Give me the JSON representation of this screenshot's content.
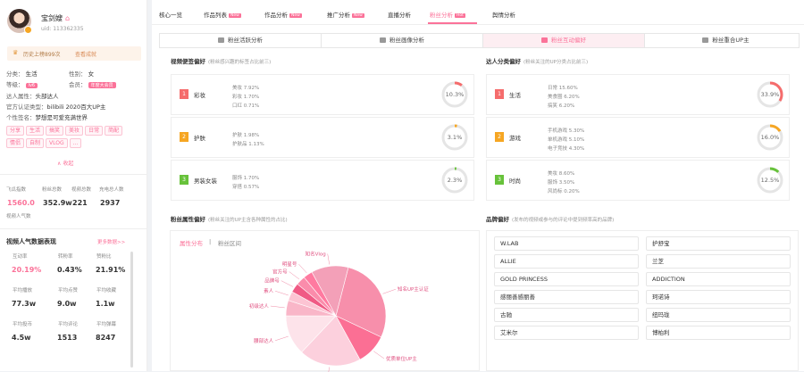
{
  "profile": {
    "name": "宝剑嫂",
    "uid": "uid: 113362335",
    "history_text": "历史上榜899次",
    "history_link": "查看成就",
    "category_label": "分类：",
    "category_value": "生活",
    "gender_label": "性别：",
    "gender_value": "女",
    "level_label": "等级：",
    "level_value": "lv6",
    "member_label": "会员：",
    "member_value": "年度大会员",
    "attr_label": "达人属性：",
    "attr_value": "头部达人",
    "cert_label": "官方认证类型：",
    "cert_value": "bilibili 2020百大UP主",
    "sign_label": "个性签名：",
    "sign_value": "梦想是可爱充满世界",
    "tags": [
      "分享",
      "生活",
      "搞笑",
      "美妆",
      "日常",
      "简配",
      "情侣",
      "自制",
      "VLOG",
      "..."
    ],
    "collapse_label": "收起"
  },
  "stats1": {
    "labels": [
      "飞瓜指数",
      "粉丝总数",
      "视频总数",
      "充电总人数"
    ],
    "values": [
      "1560.0",
      "352.9w",
      "221",
      "2937"
    ],
    "sub_label": "视频人气数"
  },
  "popularity": {
    "title": "视频人气数据表现",
    "more": "更多数据>>",
    "rows": [
      {
        "labels": [
          "互动率",
          "转粉率",
          "赞粉比"
        ],
        "values": [
          "20.19%",
          "0.43%",
          "21.91%"
        ]
      },
      {
        "labels": [
          "平均播放",
          "平均点赞",
          "平均收藏"
        ],
        "values": [
          "77.3w",
          "9.0w",
          "1.1w"
        ]
      },
      {
        "labels": [
          "平均投币",
          "平均评论",
          "平均弹幕"
        ],
        "values": [
          "4.5w",
          "1513",
          "8247"
        ]
      }
    ]
  },
  "nav": {
    "items": [
      {
        "label": "核心一览",
        "badge": ""
      },
      {
        "label": "作品列表",
        "badge": "New"
      },
      {
        "label": "作品分析",
        "badge": "New"
      },
      {
        "label": "推广分析",
        "badge": "New"
      },
      {
        "label": "直播分析",
        "badge": ""
      },
      {
        "label": "粉丝分析",
        "badge": "Hot"
      },
      {
        "label": "舆情分析",
        "badge": ""
      }
    ]
  },
  "subtabs": [
    "粉丝活跃分析",
    "粉丝画像分析",
    "粉丝互动偏好",
    "粉丝重合UP主"
  ],
  "video_pref": {
    "title": "视频便签偏好",
    "hint": "(粉丝感兴趣的标签占比前三)",
    "items": [
      {
        "rank": "1",
        "name": "彩妆",
        "subs": [
          "美妆 7.92%",
          "彩妆 1.70%",
          "口红 0.71%"
        ],
        "pct": "10.3%",
        "value": 10.3
      },
      {
        "rank": "2",
        "name": "护肤",
        "subs": [
          "护肤 1.98%",
          "护肤品 1.13%"
        ],
        "pct": "3.1%",
        "value": 3.1
      },
      {
        "rank": "3",
        "name": "男装女装",
        "subs": [
          "服饰 1.70%",
          "穿搭 0.57%"
        ],
        "pct": "2.3%",
        "value": 2.3
      }
    ]
  },
  "up_pref": {
    "title": "达人分类偏好",
    "hint": "(粉丝关注的UP分类占比前三)",
    "items": [
      {
        "rank": "1",
        "name": "生活",
        "subs": [
          "日常 15.60%",
          "美食圈 6.20%",
          "搞笑 6.20%"
        ],
        "pct": "33.9%",
        "value": 33.9
      },
      {
        "rank": "2",
        "name": "游戏",
        "subs": [
          "手机游戏 5.30%",
          "单机游戏 5.10%",
          "电子竞技 4.30%"
        ],
        "pct": "16.0%",
        "value": 16.0
      },
      {
        "rank": "3",
        "name": "时尚",
        "subs": [
          "美妆 8.60%",
          "服饰 3.50%",
          "风尚标 0.20%"
        ],
        "pct": "12.5%",
        "value": 12.5
      }
    ]
  },
  "fan_attr": {
    "title": "粉丝属性偏好",
    "hint": "(粉丝关注的UP主含各种属性的占比)",
    "tab_active": "属性分布",
    "tab_other": "粉丝区间"
  },
  "chart_data": {
    "type": "pie",
    "series": [
      {
        "label": "知名UP主认证",
        "value": 28
      },
      {
        "label": "优质单位UP主",
        "value": 10
      },
      {
        "label": "头部达人",
        "value": 20
      },
      {
        "label": "腰部达人",
        "value": 13
      },
      {
        "label": "初级达人",
        "value": 5
      },
      {
        "label": "素人",
        "value": 3
      },
      {
        "label": "品牌号",
        "value": 3
      },
      {
        "label": "官方号",
        "value": 3
      },
      {
        "label": "明星号",
        "value": 3
      },
      {
        "label": "知名Vlog",
        "value": 12
      }
    ]
  },
  "brand_pref": {
    "title": "品牌偏好",
    "hint": "(发布的视频或参与的评论中提到频率高的品牌)",
    "brands": [
      "W.LAB",
      "护舒宝",
      "ALLIE",
      "兰芝",
      "GOLD PRINCESS",
      "ADDICTION",
      "感丽善感丽善",
      "珂诺诗",
      "古驰",
      "纽玛珑",
      "艾米尔",
      "博柏利"
    ]
  },
  "colors": {
    "accent": "#fb7299",
    "rank1": "#f56c6c",
    "rank2": "#f6a623",
    "rank3": "#67c23a"
  }
}
